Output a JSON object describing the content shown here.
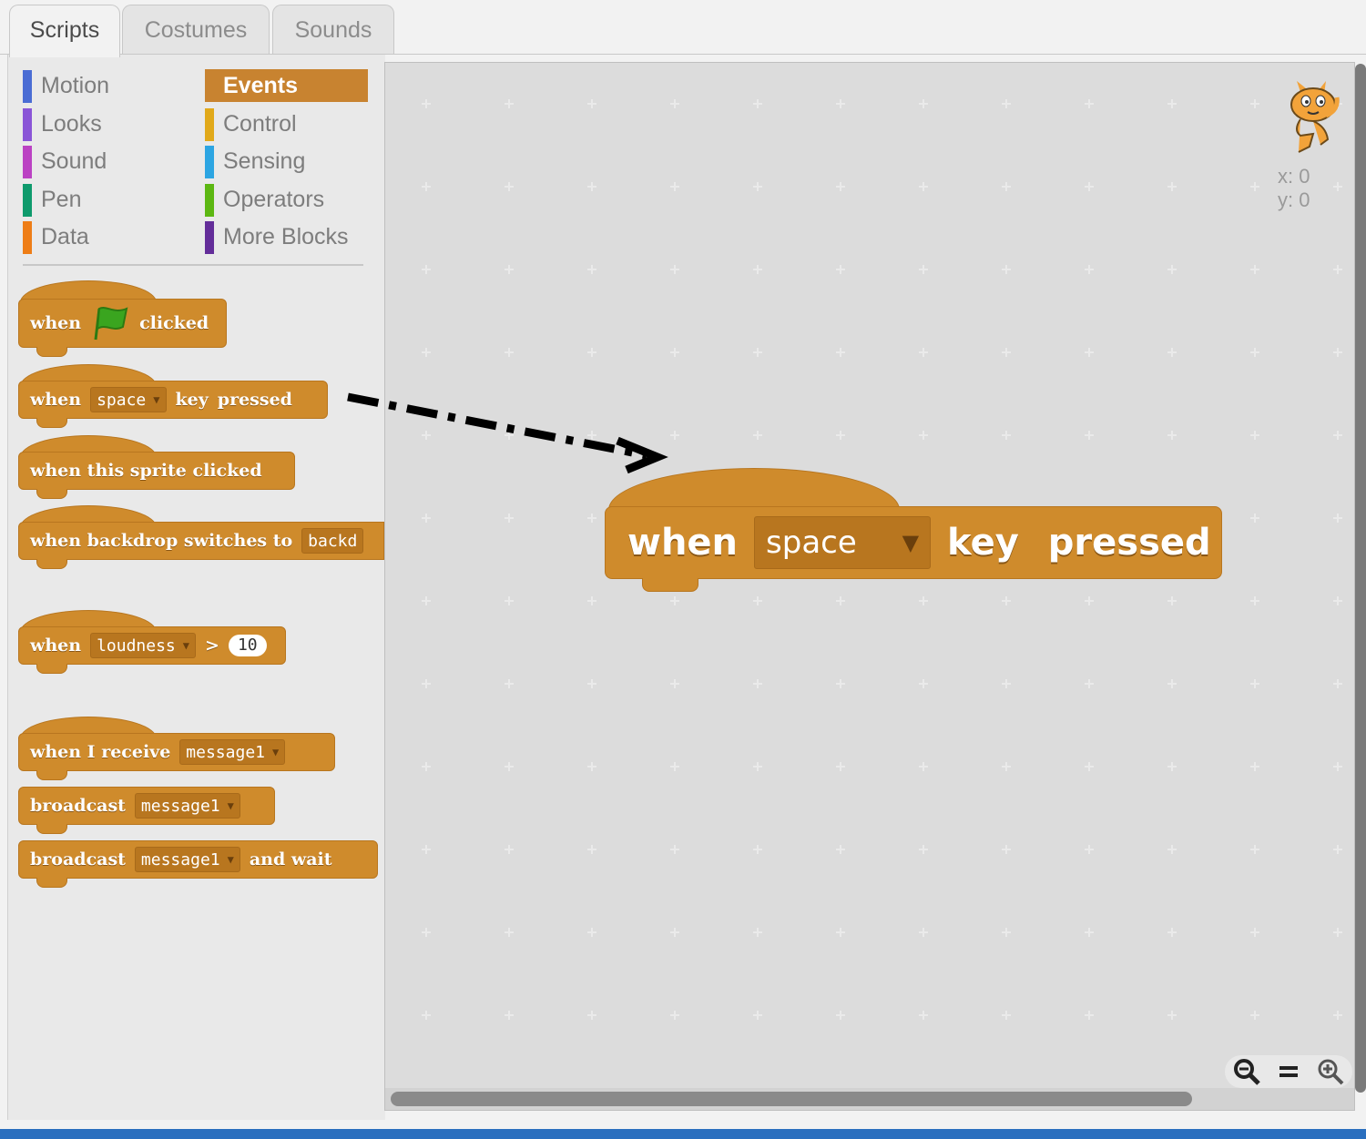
{
  "tabs": [
    {
      "label": "Scripts",
      "active": true
    },
    {
      "label": "Costumes",
      "active": false
    },
    {
      "label": "Sounds",
      "active": false
    }
  ],
  "categories": [
    {
      "label": "Motion",
      "color": "#4a6cd4"
    },
    {
      "label": "Looks",
      "color": "#8a55d7"
    },
    {
      "label": "Sound",
      "color": "#bb42c3"
    },
    {
      "label": "Pen",
      "color": "#0e9a6c"
    },
    {
      "label": "Data",
      "color": "#ee7d16"
    },
    {
      "label": "Events",
      "color": "#c88330",
      "selected": true
    },
    {
      "label": "Control",
      "color": "#e1a91a"
    },
    {
      "label": "Sensing",
      "color": "#2ca5e2"
    },
    {
      "label": "Operators",
      "color": "#5cb712"
    },
    {
      "label": "More Blocks",
      "color": "#632d99"
    }
  ],
  "blocks": {
    "flag": {
      "when": "when",
      "clicked": "clicked"
    },
    "key": {
      "when": "when",
      "key": "space",
      "key_pressed": "key",
      "pressed": "pressed"
    },
    "sprite": {
      "text": "when this sprite clicked"
    },
    "backdrop": {
      "text": "when backdrop switches to",
      "value": "backd"
    },
    "loudness": {
      "when": "when",
      "sensor": "loudness",
      "op": ">",
      "value": "10"
    },
    "receive": {
      "text": "when I receive",
      "value": "message1"
    },
    "broadcast": {
      "text": "broadcast",
      "value": "message1"
    },
    "broadcast_wait": {
      "text": "broadcast",
      "value": "message1",
      "suffix": "and wait"
    }
  },
  "script_area": {
    "block": {
      "when": "when",
      "key": "space",
      "key_word": "key",
      "pressed": "pressed"
    },
    "coords": {
      "x": "x: 0",
      "y": "y: 0"
    }
  },
  "colors": {
    "events": "#cf8b2c",
    "flag": "#3aa51f"
  }
}
